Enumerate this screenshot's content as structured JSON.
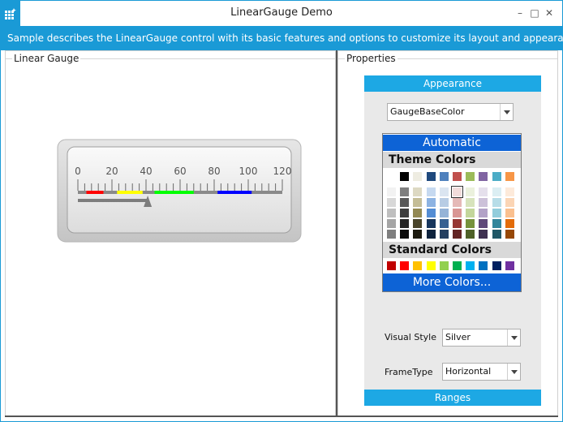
{
  "window": {
    "title": "LinearGauge Demo",
    "minimize": "–",
    "maximize": "□",
    "close": "✕"
  },
  "banner": "Sample describes the LinearGauge control with its basic features and options to customize its layout and appearance",
  "left_panel": {
    "header": "Linear Gauge"
  },
  "right_panel": {
    "header": "Properties"
  },
  "gauge": {
    "scale_labels": [
      "0",
      "20",
      "40",
      "60",
      "80",
      "100",
      "120"
    ],
    "min": 0,
    "max": 120,
    "pointer_value": 41,
    "ranges": [
      {
        "from": 5,
        "to": 15,
        "color": "#ff0000"
      },
      {
        "from": 23,
        "to": 38,
        "color": "#ffff00"
      },
      {
        "from": 45,
        "to": 68,
        "color": "#00ff00"
      },
      {
        "from": 82,
        "to": 102,
        "color": "#0000ff"
      }
    ]
  },
  "appearance": {
    "section_title": "Appearance",
    "property_combo": "GaugeBaseColor",
    "palette": {
      "automatic": "Automatic",
      "theme_header": "Theme Colors",
      "standard_header": "Standard Colors",
      "more": "More Colors...",
      "theme_top": [
        "#ffffff",
        "#000000",
        "#eeece1",
        "#1f497d",
        "#4f81bd",
        "#c0504d",
        "#9bbb59",
        "#8064a2",
        "#4bacc6",
        "#f79646"
      ],
      "theme_shades": [
        [
          "#f2f2f2",
          "#d8d8d8",
          "#bfbfbf",
          "#a5a5a5",
          "#7f7f7f"
        ],
        [
          "#7f7f7f",
          "#595959",
          "#3f3f3f",
          "#262626",
          "#0c0c0c"
        ],
        [
          "#ddd9c3",
          "#c4bd97",
          "#938953",
          "#494429",
          "#1d1b10"
        ],
        [
          "#c6d9f0",
          "#8db3e2",
          "#548dd4",
          "#17365d",
          "#0f243e"
        ],
        [
          "#dbe5f1",
          "#b8cce4",
          "#95b3d7",
          "#366092",
          "#244061"
        ],
        [
          "#f2dcdb",
          "#e5b9b7",
          "#d99694",
          "#953734",
          "#632423"
        ],
        [
          "#ebf1dd",
          "#d7e3bc",
          "#c3d69b",
          "#76923c",
          "#4f6128"
        ],
        [
          "#e5e0ec",
          "#ccc1d9",
          "#b2a2c7",
          "#5f497a",
          "#3f3151"
        ],
        [
          "#dbeef3",
          "#b7dde8",
          "#92cddc",
          "#31859b",
          "#205867"
        ],
        [
          "#fdeada",
          "#fbd5b5",
          "#fac08f",
          "#e36c09",
          "#974806"
        ]
      ],
      "selected_column": 5,
      "selected_row": 0,
      "standard": [
        "#c00000",
        "#ff0000",
        "#ffc000",
        "#ffff00",
        "#92d050",
        "#00b050",
        "#00b0f0",
        "#0070c0",
        "#002060",
        "#7030a0"
      ]
    },
    "visual_style_label": "Visual Style",
    "visual_style_value": "Silver",
    "frametype_label": "FrameType",
    "frametype_value": "Horizontal"
  },
  "ranges_section": {
    "title": "Ranges"
  }
}
